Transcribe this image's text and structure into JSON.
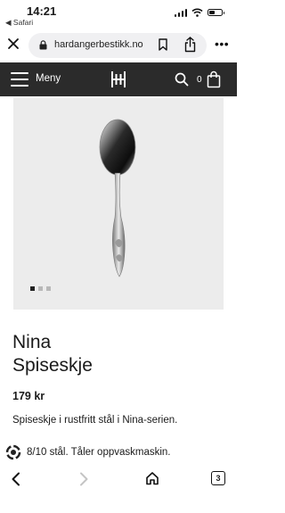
{
  "status_bar": {
    "time": "14:21",
    "back_app": "◀ Safari"
  },
  "browser": {
    "url": "hardangerbestikk.no",
    "tabs_count": "3"
  },
  "site_header": {
    "menu_label": "Meny",
    "cart_count": "0"
  },
  "product": {
    "title_line1": "Nina",
    "title_line2": "Spiseskje",
    "price": "179 kr",
    "description": "Spiseskje i rustfritt stål i Nina-serien.",
    "description_line2": "8/10 stål. Tåler oppvaskmaskin.",
    "image_dots": {
      "count": 3,
      "active_index": 0
    }
  },
  "colors": {
    "header_bg": "#2b2b2b",
    "image_bg": "#ececec",
    "dot_active": "#222222",
    "dot_inactive": "#b8b8b8"
  },
  "icons": [
    "close-icon",
    "lock-icon",
    "bookmark-icon",
    "share-icon",
    "more-icon",
    "hamburger-icon",
    "logo-icon",
    "search-icon",
    "cart-icon",
    "back-icon",
    "forward-icon",
    "home-icon",
    "tabs-icon"
  ]
}
